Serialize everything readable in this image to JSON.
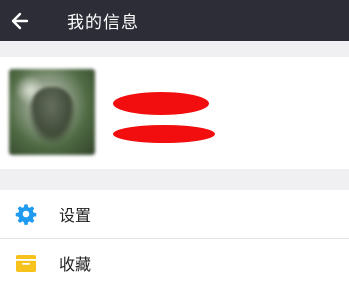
{
  "header": {
    "title": "我的信息",
    "back_icon": "back-arrow-icon"
  },
  "profile": {
    "name": "",
    "id": ""
  },
  "menu": {
    "items": [
      {
        "label": "设置",
        "icon": "gear-icon",
        "color": "#1e9bf0"
      },
      {
        "label": "收藏",
        "icon": "folder-icon",
        "color": "#f7c21b"
      }
    ]
  },
  "colors": {
    "topbar": "#2c2d36",
    "background": "#f0f0f2",
    "redaction": "#f20e0e"
  }
}
